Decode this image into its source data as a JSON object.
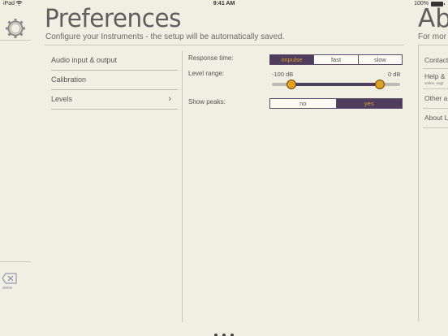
{
  "status_bar": {
    "carrier": "iPad",
    "time": "9:41 AM",
    "battery": "100%"
  },
  "left_panel": {
    "delete_label": "delete"
  },
  "header": {
    "title": "Preferences",
    "subtitle": "Configure your Instruments - the setup will be automatically saved."
  },
  "menu": {
    "items": [
      {
        "label": "Audio input & output"
      },
      {
        "label": "Calibration"
      },
      {
        "label": "Levels",
        "chevron": "›"
      }
    ]
  },
  "settings": {
    "response_time": {
      "label": "Response time:",
      "options": [
        "impulse",
        "fast",
        "slow"
      ],
      "selected": "impulse"
    },
    "level_range": {
      "label": "Level range:",
      "min_label": "-100 dB",
      "max_label": "0 dB",
      "low_fraction": 0.15,
      "high_fraction": 0.84
    },
    "show_peaks": {
      "label": "Show peaks:",
      "options": [
        "no",
        "yes"
      ],
      "selected": "yes"
    }
  },
  "next_page": {
    "title": "Ab",
    "subtitle": "For mor",
    "items": [
      {
        "label": "Contact"
      },
      {
        "label": "Help &",
        "sub": "online, engl"
      },
      {
        "label": "Other a"
      },
      {
        "label": "About L"
      }
    ]
  },
  "page_indicator": {
    "count": 3,
    "current": 0
  },
  "colors": {
    "background": "#f1efe1",
    "accent": "#4e3d5c",
    "highlight": "#e29a2a"
  }
}
